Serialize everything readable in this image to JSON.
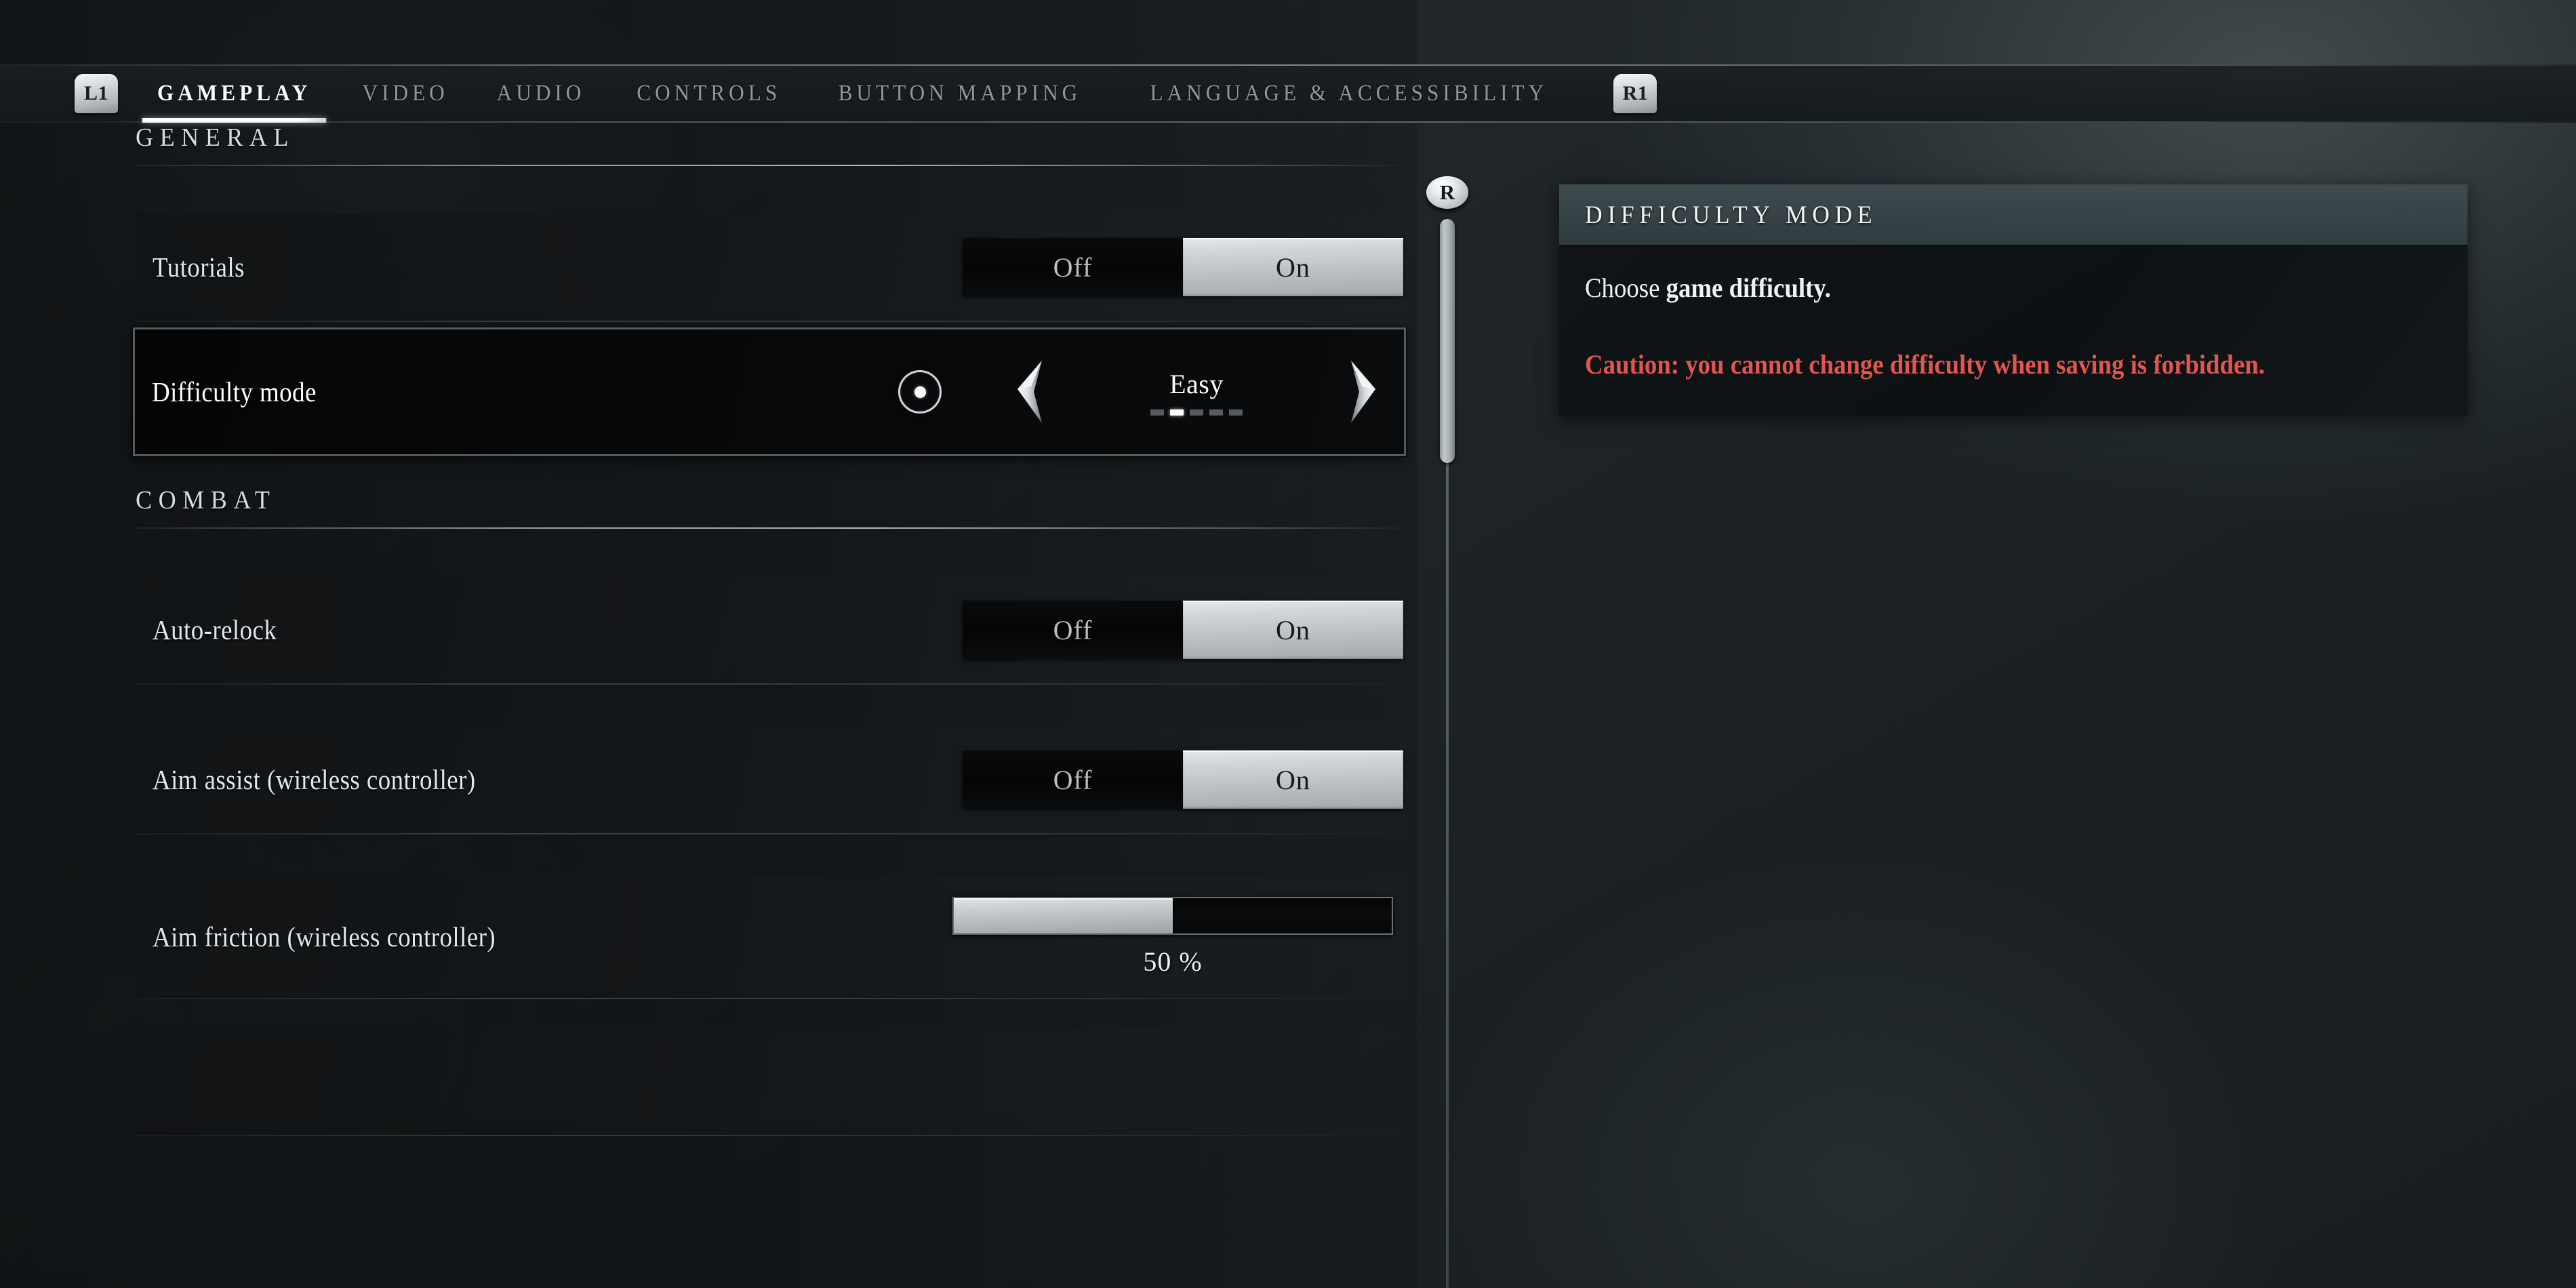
{
  "tabs": {
    "left_bumper": "L1",
    "right_bumper": "R1",
    "items": [
      {
        "label": "GAMEPLAY",
        "active": true
      },
      {
        "label": "VIDEO",
        "active": false
      },
      {
        "label": "AUDIO",
        "active": false
      },
      {
        "label": "CONTROLS",
        "active": false
      },
      {
        "label": "BUTTON MAPPING",
        "active": false
      },
      {
        "label": "LANGUAGE & ACCESSIBILITY",
        "active": false
      }
    ]
  },
  "sections": [
    {
      "title": "GENERAL",
      "rows": [
        {
          "label": "Tutorials",
          "control": "toggle",
          "off_label": "Off",
          "on_label": "On",
          "value": "On",
          "selected": false
        },
        {
          "label": "Difficulty mode",
          "control": "stepper",
          "value": "Easy",
          "steps": 5,
          "step_index": 2,
          "left_arrow": "chevron-left-icon",
          "right_arrow": "chevron-right-icon",
          "selected": true
        }
      ]
    },
    {
      "title": "COMBAT",
      "rows": [
        {
          "label": "Auto-relock",
          "control": "toggle",
          "off_label": "Off",
          "on_label": "On",
          "value": "On",
          "selected": false
        },
        {
          "label": "Aim assist (wireless controller)",
          "control": "toggle",
          "off_label": "Off",
          "on_label": "On",
          "value": "On",
          "selected": false
        },
        {
          "label": "Aim friction (wireless controller)",
          "control": "slider",
          "value": "50 %",
          "percent": 50,
          "selected": false
        }
      ]
    }
  ],
  "scroll": {
    "stick_button": "R"
  },
  "info_panel": {
    "title": "DIFFICULTY MODE",
    "description_plain": "Choose ",
    "description_bold": "game difficulty.",
    "caution": "Caution: you cannot change difficulty when saving is forbidden.",
    "caution_color": "#e2564f"
  }
}
